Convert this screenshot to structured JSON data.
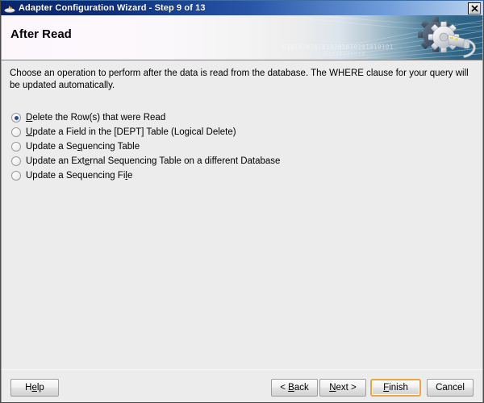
{
  "window": {
    "title": "Adapter Configuration Wizard - Step 9 of 13",
    "icon": "wizard-coffee-icon",
    "close_label": "x"
  },
  "banner": {
    "title": "After Read",
    "graphic": "gear-and-plug-icon",
    "binary_text": "0101010101010101010101010101",
    "binary_text_2": "01010101010"
  },
  "body": {
    "description": "Choose an operation to perform after the data is read from the database.  The WHERE clause for your query will be updated automatically.",
    "options": [
      {
        "label": "Delete the Row(s) that were Read",
        "mnemonic": "D",
        "mnemonic_index": 0,
        "checked": true,
        "name": "radio-delete-rows"
      },
      {
        "label": "Update a Field in the [DEPT] Table (Logical Delete)",
        "mnemonic": "U",
        "mnemonic_index": 0,
        "checked": false,
        "name": "radio-update-field-logical-delete"
      },
      {
        "label": "Update a Sequencing Table",
        "mnemonic": "S",
        "mnemonic_index": 11,
        "checked": false,
        "name": "radio-update-sequencing-table"
      },
      {
        "label": "Update an External Sequencing Table on a different Database",
        "mnemonic": "E",
        "mnemonic_index": 13,
        "checked": false,
        "name": "radio-update-external-sequencing-table"
      },
      {
        "label": "Update a Sequencing File",
        "mnemonic": "F",
        "mnemonic_index": 22,
        "checked": false,
        "name": "radio-update-sequencing-file"
      }
    ]
  },
  "footer": {
    "buttons": [
      {
        "label": "Help",
        "mnemonic_index": 1,
        "default": false,
        "name": "help-button"
      },
      {
        "label": "< Back",
        "mnemonic_index": 2,
        "default": false,
        "name": "back-button"
      },
      {
        "label": "Next >",
        "mnemonic_index": 0,
        "default": false,
        "name": "next-button"
      },
      {
        "label": "Finish",
        "mnemonic_index": 0,
        "default": true,
        "name": "finish-button"
      },
      {
        "label": "Cancel",
        "mnemonic_index": -1,
        "default": false,
        "name": "cancel-button"
      }
    ]
  },
  "colors": {
    "titlebar_start": "#0a246a",
    "titlebar_end": "#bcd4ee",
    "body_bg": "#ECECEC",
    "banner_left": "#f7f2f6",
    "banner_right": "#2d6383",
    "accent_default_button": "#e9a63c",
    "radio_dot": "#2c4b8e"
  }
}
